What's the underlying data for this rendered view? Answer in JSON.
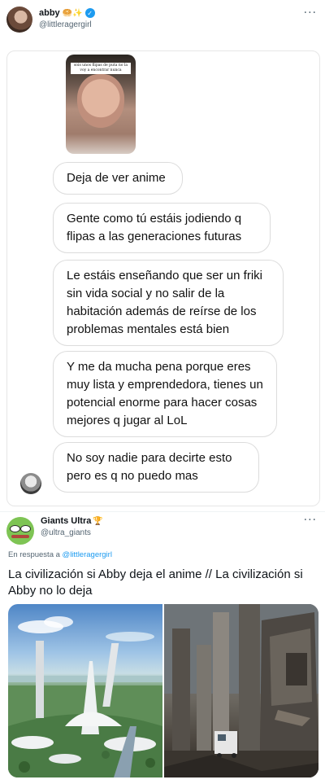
{
  "tweet": {
    "author": {
      "display_name": "abby",
      "emojis": "🥯✨",
      "handle": "@littleragergirl"
    },
    "more_label": "···",
    "screenshot_caption": "sois unos flipas de puta no la voy a encontrar nunca",
    "messages": [
      "Deja de ver anime",
      "Gente como tú estáis jodiendo q flipas a las generaciones futuras",
      "Le estáis enseñando que ser un friki sin vida social y no salir de la habitación además de reírse de los problemas mentales está bien",
      "Y me da mucha pena porque eres muy lista y emprendedora, tienes un potencial enorme para hacer cosas mejores q jugar al LoL",
      "No soy nadie para decirte esto pero es q no puedo mas"
    ]
  },
  "reply": {
    "author": {
      "display_name": "Giants Ultra",
      "emoji": "🏆",
      "handle": "@ultra_giants"
    },
    "more_label": "···",
    "in_reply_prefix": "En respuesta a",
    "in_reply_handle": "@littleragergirl",
    "text": "La civilización si Abby deja el anime //  La civilización si Abby no lo deja"
  },
  "colors": {
    "link": "#1d9bf0",
    "secondary_text": "#536471",
    "bubble_border": "#dcdcdc"
  }
}
